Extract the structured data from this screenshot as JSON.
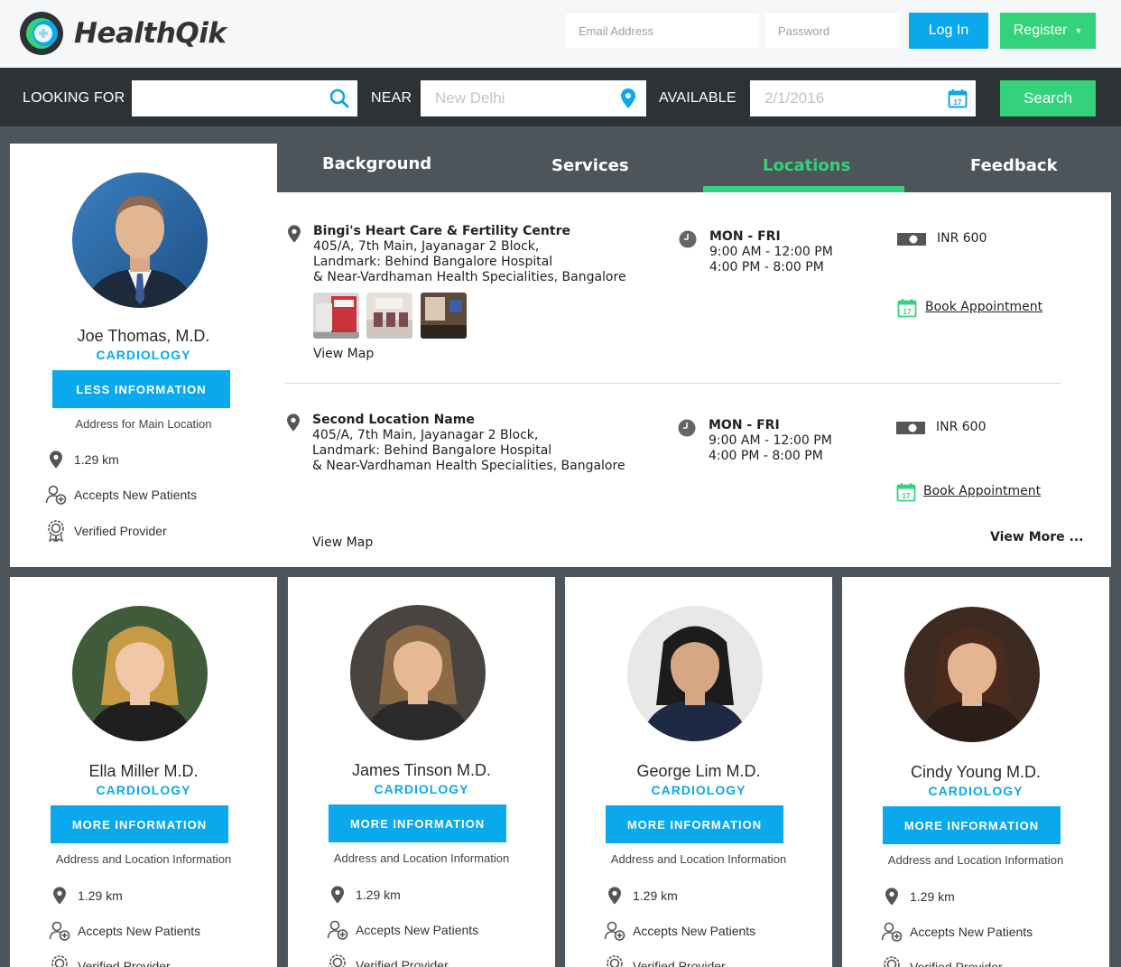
{
  "brand": {
    "name": "HealthQik"
  },
  "auth": {
    "email_placeholder": "Email Address",
    "password_placeholder": "Password",
    "login_label": "Log In",
    "register_label": "Register"
  },
  "search": {
    "looking_for_label": "LOOKING FOR",
    "near_label": "NEAR",
    "near_placeholder": "New Delhi",
    "available_label": "AVAILABLE",
    "date_placeholder": "2/1/2016",
    "button_label": "Search",
    "calendar_day": "17"
  },
  "main_doctor": {
    "name": "Joe Thomas, M.D.",
    "specialty": "CARDIOLOGY",
    "button_label": "LESS INFORMATION",
    "address": "Address for Main Location",
    "distance": "1.29 km",
    "accepts": "Accepts New Patients",
    "verified": "Verified Provider"
  },
  "tabs": [
    {
      "label": "Background"
    },
    {
      "label": "Services"
    },
    {
      "label": "Locations"
    },
    {
      "label": "Feedback"
    }
  ],
  "active_tab": "Locations",
  "locations": [
    {
      "name": "Bingi's Heart Care & Fertility Centre",
      "address_lines": [
        "405/A, 7th Main, Jayanagar 2 Block,",
        "Landmark: Behind Bangalore Hospital",
        "& Near-Vardhaman Health Specialities, Bangalore"
      ],
      "view_map": "View Map",
      "days": "MON - FRI",
      "hours": [
        "9:00 AM - 12:00 PM",
        "4:00 PM - 8:00 PM"
      ],
      "fee": "INR 600",
      "book_label": "Book Appointment"
    },
    {
      "name": "Second Location Name",
      "address_lines": [
        "405/A, 7th Main, Jayanagar 2 Block,",
        "Landmark: Behind Bangalore Hospital",
        "& Near-Vardhaman Health Specialities, Bangalore"
      ],
      "view_map": "View Map",
      "days": "MON - FRI",
      "hours": [
        "9:00 AM - 12:00 PM",
        "4:00 PM - 8:00 PM"
      ],
      "fee": "INR 600",
      "book_label": "Book Appointment"
    }
  ],
  "view_more": "View More ...",
  "doctors": [
    {
      "name": "Ella Miller M.D.",
      "specialty": "CARDIOLOGY",
      "button_label": "MORE INFORMATION",
      "address": "Address and Location Information",
      "distance": "1.29 km",
      "accepts": "Accepts New Patients",
      "verified": "Verified Provider"
    },
    {
      "name": "James Tinson M.D.",
      "specialty": "CARDIOLOGY",
      "button_label": "MORE INFORMATION",
      "address": "Address and Location Information",
      "distance": "1.29 km",
      "accepts": "Accepts New Patients",
      "verified": "Verified Provider"
    },
    {
      "name": "George Lim M.D.",
      "specialty": "CARDIOLOGY",
      "button_label": "MORE INFORMATION",
      "address": "Address and Location Information",
      "distance": "1.29 km",
      "accepts": "Accepts New Patients",
      "verified": "Verified Provider"
    },
    {
      "name": "Cindy Young M.D.",
      "specialty": "CARDIOLOGY",
      "button_label": "MORE INFORMATION",
      "address": "Address and Location Information",
      "distance": "1.29 km",
      "accepts": "Accepts New Patients",
      "verified": "Verified Provider"
    }
  ],
  "colors": {
    "accent_blue": "#0aa8ed",
    "accent_green": "#34d27b",
    "dark_bar": "#2d3236",
    "panel_gray": "#4d555b"
  }
}
